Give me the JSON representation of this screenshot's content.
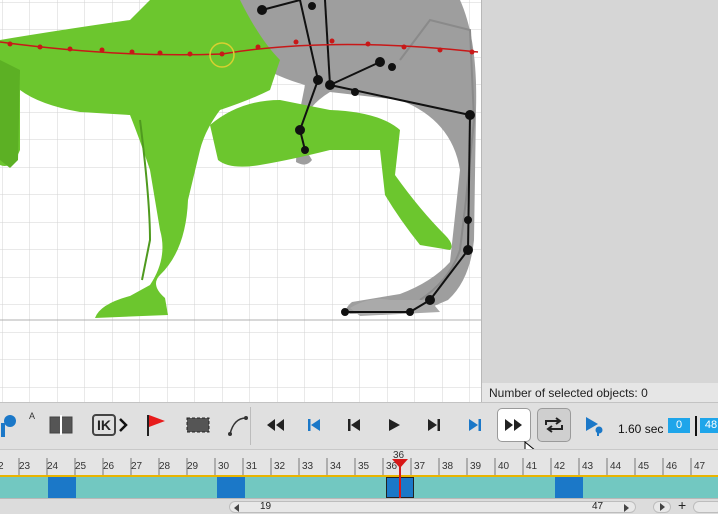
{
  "status": {
    "selected_objects_text": "Number of selected objects: 0"
  },
  "toolbar": {
    "key_icon": "key-icon",
    "auto_key_label": "A",
    "ik_label": "IK",
    "time_readout": "1.60 sec",
    "frame_start": "0",
    "frame_end": "48",
    "accent": "#1b78c8"
  },
  "timeline": {
    "frame_labels": [
      "2",
      "23",
      "24",
      "25",
      "26",
      "27",
      "28",
      "29",
      "30",
      "31",
      "32",
      "33",
      "34",
      "35",
      "36",
      "37",
      "38",
      "39",
      "40",
      "41",
      "42",
      "43",
      "44",
      "45",
      "46",
      "47"
    ],
    "current_frame": "36",
    "playhead_color": "#d81818",
    "track_color": "#72c8c1",
    "key_color": "#1b78c8"
  },
  "range": {
    "start": "19",
    "end": "47",
    "add_label": "+"
  }
}
